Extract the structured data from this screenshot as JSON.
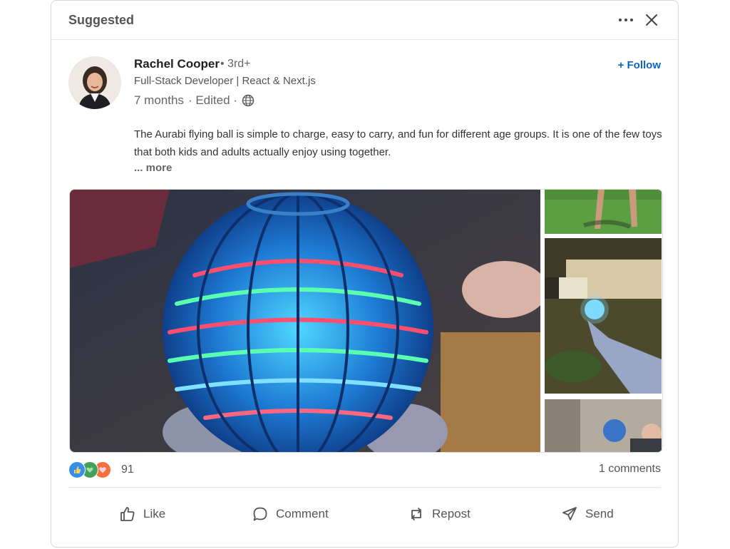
{
  "header": {
    "title": "Suggested",
    "more_icon": "ellipsis-icon",
    "close_icon": "close-icon"
  },
  "author": {
    "name": "Rachel Cooper",
    "degree": "• 3rd+",
    "headline": "Full-Stack Developer | React & Next.js",
    "time": "7 months",
    "edited": "· Edited ·",
    "visibility_icon": "globe-icon",
    "follow_label": "+ Follow"
  },
  "post": {
    "text": "The Aurabi flying ball is simple to charge, easy to carry, and fun for different age groups. It is one of the few toys that both kids and adults actually enjoy using together.",
    "see_more": "... more"
  },
  "engagement": {
    "reaction_count": "91",
    "comments": "1 comments",
    "reaction_icons": [
      "like-reaction-icon",
      "support-reaction-icon",
      "love-reaction-icon"
    ]
  },
  "actions": [
    {
      "label": "Like",
      "icon": "thumbs-up-icon"
    },
    {
      "label": "Comment",
      "icon": "comment-icon"
    },
    {
      "label": "Repost",
      "icon": "repost-icon"
    },
    {
      "label": "Send",
      "icon": "send-icon"
    }
  ],
  "colors": {
    "accent": "#0a66c2",
    "like": "#378fe9",
    "support": "#44a05a",
    "love": "#f5703d"
  }
}
